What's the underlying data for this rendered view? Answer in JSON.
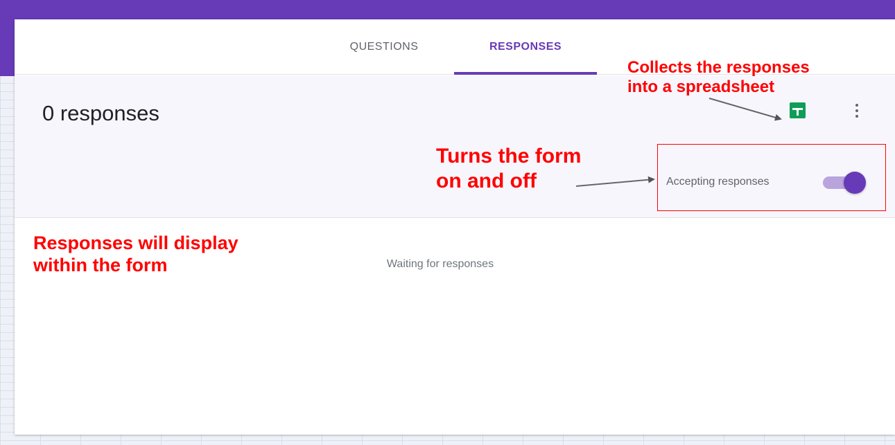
{
  "tabs": {
    "questions": "QUESTIONS",
    "responses": "RESPONSES"
  },
  "summary": {
    "count_label": "0 responses",
    "accepting_label": "Accepting responses",
    "accepting_on": true
  },
  "empty_state": "Waiting for responses",
  "annotations": {
    "sheets_line1": "Collects the responses",
    "sheets_line2": "into a spreadsheet",
    "toggle_line1": "Turns the form",
    "toggle_line2": "on and off",
    "display_line1": "Responses will display",
    "display_line2": "within the form"
  },
  "icons": {
    "spreadsheet": "sheets-icon",
    "more": "more-vert-icon"
  },
  "colors": {
    "accent": "#673ab7",
    "annotation": "#ff0000",
    "sheets": "#0f9d58"
  }
}
